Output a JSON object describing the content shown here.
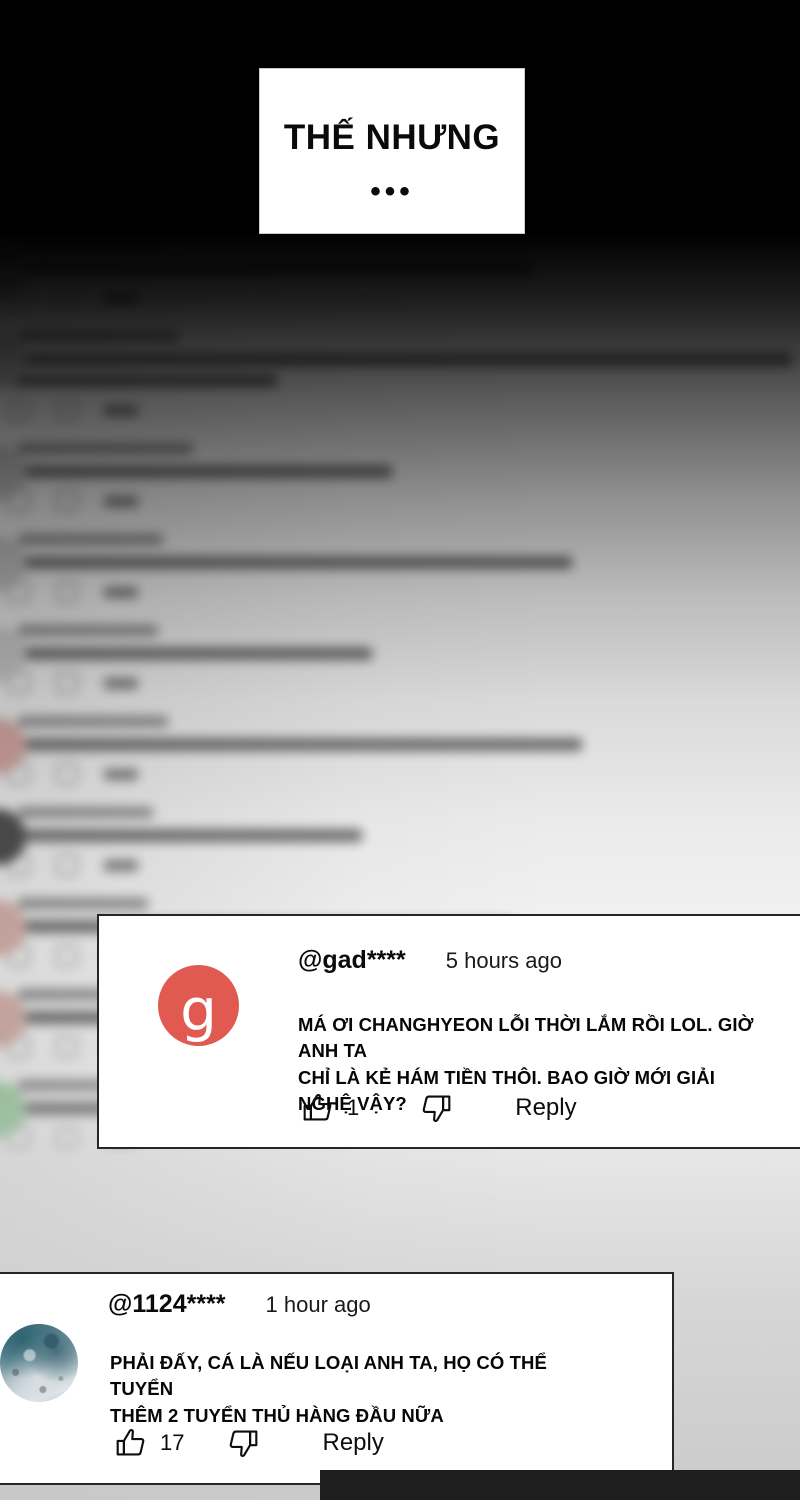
{
  "slide": {
    "title_card": {
      "text": "THẾ NHƯNG",
      "ellipsis": "•••"
    }
  },
  "background": {
    "description": "blurred-comment-feed",
    "gradient_top_color": "#000000",
    "gradient_bottom_color": "#c6c6c6",
    "blurred_rows": [
      {
        "avatar_color": "#b9b9b9",
        "name_width": 150,
        "text_width": 520,
        "text2_width": 0
      },
      {
        "avatar_color": "#bdbdbd",
        "name_width": 160,
        "text_width": 780,
        "text2_width": 265
      },
      {
        "avatar_color": "#c2c2c2",
        "name_width": 175,
        "text_width": 380,
        "text2_width": 0
      },
      {
        "avatar_color": "#c6c6c6",
        "name_width": 145,
        "text_width": 560,
        "text2_width": 0
      },
      {
        "avatar_color": "#cfcfcf",
        "name_width": 140,
        "text_width": 360,
        "text2_width": 0
      },
      {
        "avatar_color": "#d8a9a4",
        "name_width": 150,
        "text_width": 570,
        "text2_width": 0
      },
      {
        "avatar_color": "#4a4a4a",
        "name_width": 135,
        "text_width": 350,
        "text2_width": 0
      },
      {
        "avatar_color": "#d8b0aa",
        "name_width": 130,
        "text_width": 500,
        "text2_width": 0
      },
      {
        "avatar_color": "#d6b2ab",
        "name_width": 155,
        "text_width": 600,
        "text2_width": 0
      },
      {
        "avatar_color": "#9fcfa4",
        "name_width": 145,
        "text_width": 540,
        "text2_width": 0
      }
    ]
  },
  "comments": [
    {
      "id": "comment-gad",
      "username": "@gad****",
      "timestamp": "5 hours ago",
      "text": "MÁ ƠI CHANGHYEON LỖI THỜI LẮM RỒI LOL. GIỜ ANH TA\nCHỈ LÀ KẺ HÁM TIỀN THÔI. BAO GIỜ MỚI GIẢI NGHỆ VẬY?",
      "like_count": "1",
      "reply_label": "Reply",
      "avatar": {
        "type": "letter",
        "letter": "g",
        "color": "#e05a52"
      }
    },
    {
      "id": "comment-1124",
      "username": "@1124****",
      "timestamp": "1 hour ago",
      "text": "PHẢI ĐẤY, CÁ LÀ NẾU LOẠI ANH TA, HỌ CÓ THỂ TUYỂN\nTHÊM 2 TUYỂN THỦ HÀNG ĐẦU NỮA",
      "like_count": "17",
      "reply_label": "Reply",
      "avatar": {
        "type": "photo",
        "letter": "",
        "color": "#6f94a0"
      }
    }
  ]
}
